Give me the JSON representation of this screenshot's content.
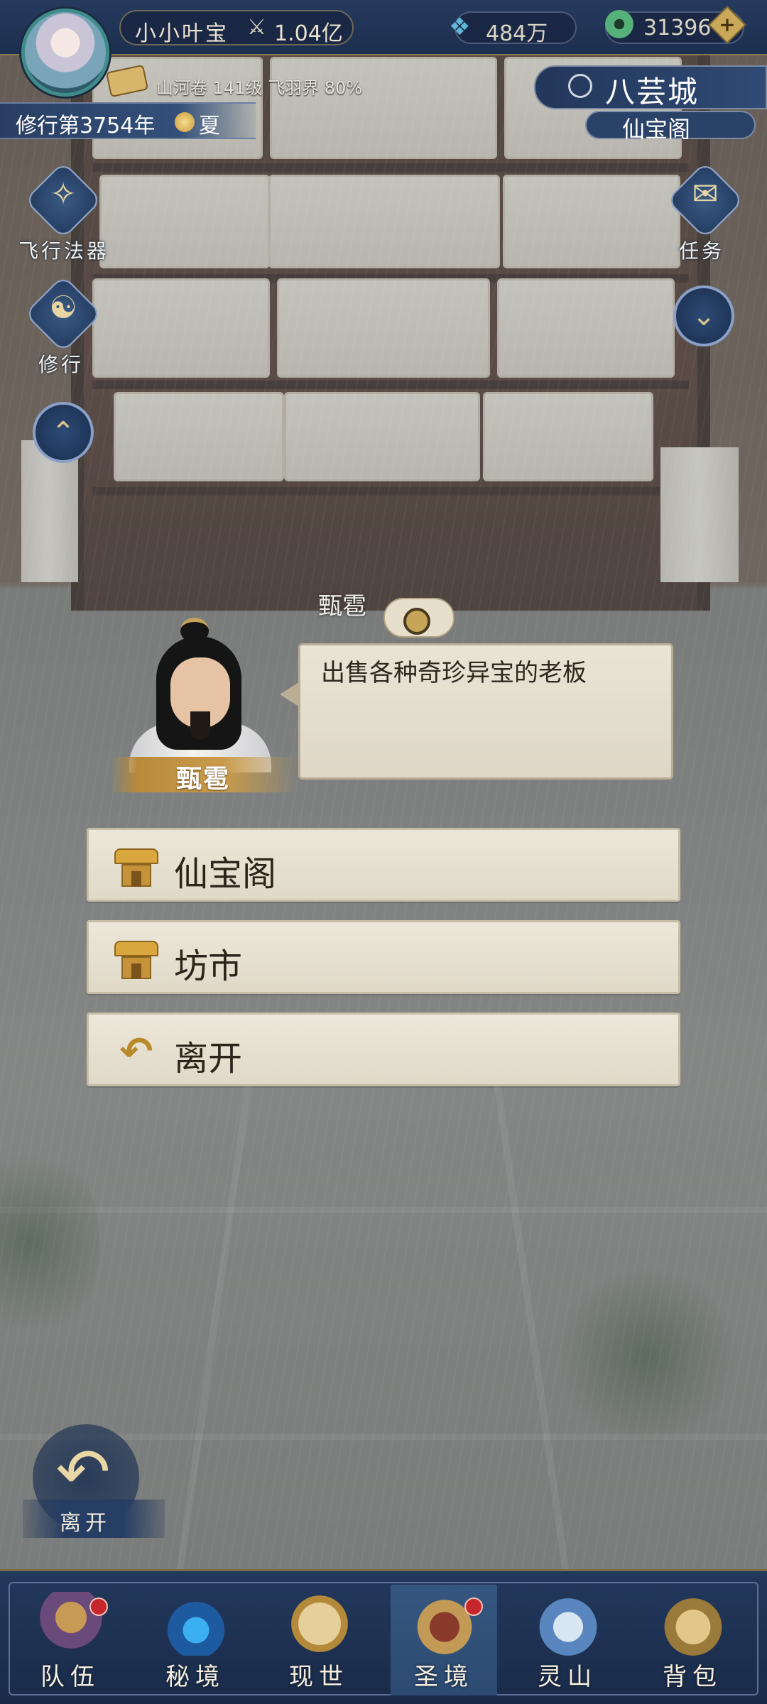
{
  "header": {
    "player_name": "小小叶宝",
    "power": "1.04亿",
    "spirit_stones": "484万",
    "jade": "31396",
    "realm_info": "山河卷 141级 飞羽界 80%",
    "cultivation_year": "修行第3754年",
    "season": "夏"
  },
  "location": {
    "city": "八芸城",
    "place": "仙宝阁"
  },
  "side_menu": {
    "flying_artifact": "飞行法器",
    "cultivate": "修行",
    "quest": "任务"
  },
  "npc": {
    "name": "甄雹",
    "description": "出售各种奇珍异宝的老板"
  },
  "options": [
    {
      "label": "仙宝阁"
    },
    {
      "label": "坊市"
    },
    {
      "label": "离开"
    }
  ],
  "leave_button": {
    "label": "离开"
  },
  "bottom_nav": [
    {
      "label": "队伍"
    },
    {
      "label": "秘境"
    },
    {
      "label": "现世"
    },
    {
      "label": "圣境"
    },
    {
      "label": "灵山"
    },
    {
      "label": "背包"
    }
  ],
  "colors": {
    "hud_blue": "#263a5e",
    "gold_accent": "#c9a85a",
    "parchment": "#ece7da",
    "notification_red": "#c4262b"
  }
}
